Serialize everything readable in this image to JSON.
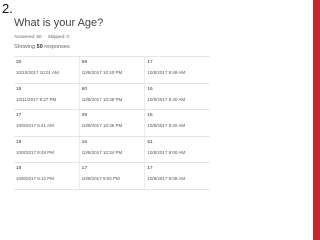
{
  "slide_number": "2.",
  "question": {
    "title": "What is your Age?"
  },
  "stats": {
    "answered": "Answered: 50",
    "skipped": "Skipped: 0"
  },
  "showing": {
    "prefix": "Showing ",
    "count": "50",
    "suffix": " responses"
  },
  "responses": [
    [
      {
        "value": "20",
        "time": "10/10/2017 10:01 AM"
      },
      {
        "value": "59",
        "time": "10/8/2017 10:40 PM"
      },
      {
        "value": "17",
        "time": "10/8/2017 9:49 AM"
      }
    ],
    [
      {
        "value": "16",
        "time": "10/11/2017 9:27 PM"
      },
      {
        "value": "60",
        "time": "10/8/2017 10:38 PM"
      },
      {
        "value": "16",
        "time": "10/8/2017 9:40 AM"
      }
    ],
    [
      {
        "value": "17",
        "time": "10/9/2017 8:41 AM"
      },
      {
        "value": "29",
        "time": "10/8/2017 10:36 PM"
      },
      {
        "value": "16",
        "time": "10/8/2017 9:20 AM"
      }
    ],
    [
      {
        "value": "18",
        "time": "10/8/2017 8:49 PM"
      },
      {
        "value": "16",
        "time": "10/8/2017 10:34 PM"
      },
      {
        "value": "61",
        "time": "10/8/2017 9:00 AM"
      }
    ],
    [
      {
        "value": "18",
        "time": "10/8/2017 8:12 PM"
      },
      {
        "value": "17",
        "time": "10/8/2017 9:02 PM"
      },
      {
        "value": "17",
        "time": "10/8/2017 8:08 AM"
      }
    ]
  ],
  "colors": {
    "accent_bar": "#c1272d"
  }
}
